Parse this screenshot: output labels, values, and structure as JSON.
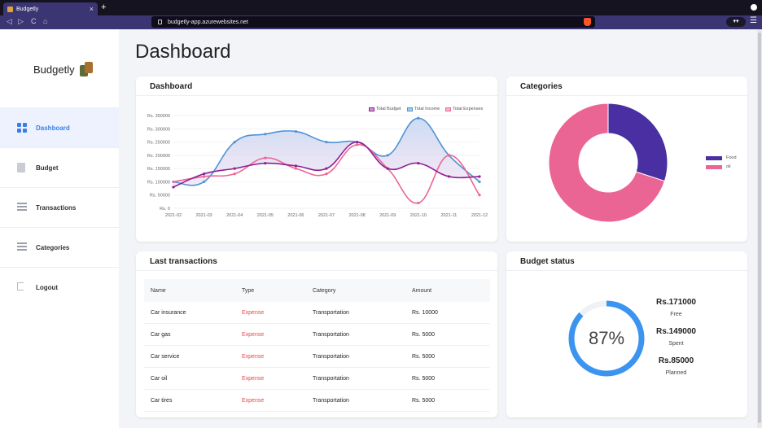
{
  "browser": {
    "tab_title": "Budgetly",
    "tab_close": "×",
    "new_tab": "+",
    "url": "budgetly-app.azurewebsites.net",
    "ext": "▾▾",
    "menu": "☰",
    "back": "◁",
    "forward": "▷",
    "reload": "C",
    "home": "⌂",
    "bookmark": "▯"
  },
  "sidebar": {
    "brand": "Budgetly",
    "items": [
      {
        "label": "Dashboard",
        "icon": "dashboard-grid-icon",
        "active": true
      },
      {
        "label": "Budget",
        "icon": "document-icon",
        "active": false
      },
      {
        "label": "Transactions",
        "icon": "list-icon",
        "active": false
      },
      {
        "label": "Categories",
        "icon": "list-icon",
        "active": false
      },
      {
        "label": "Logout",
        "icon": "logout-icon",
        "active": false
      }
    ]
  },
  "main": {
    "title": "Dashboard",
    "dashboard_card": {
      "title": "Dashboard"
    },
    "categories_card": {
      "title": "Categories"
    },
    "transactions_card": {
      "title": "Last transactions"
    },
    "budget_card": {
      "title": "Budget status"
    }
  },
  "chart_data": [
    {
      "type": "line",
      "x": [
        "2021-02",
        "2021-03",
        "2021-04",
        "2021-05",
        "2021-06",
        "2021-07",
        "2021-08",
        "2021-09",
        "2021-10",
        "2021-11",
        "2021-12"
      ],
      "ylim": [
        0,
        350000
      ],
      "yticks": [
        0,
        50000,
        100000,
        150000,
        200000,
        250000,
        300000,
        350000
      ],
      "ytick_labels": [
        "Rs. 0",
        "Rs. 50000",
        "Rs. 100000",
        "Rs. 150000",
        "Rs. 200000",
        "Rs. 250000",
        "Rs. 300000",
        "Rs. 350000"
      ],
      "legend_position": "top-right",
      "grid": true,
      "series": [
        {
          "name": "Total Budget",
          "color": "#8e1f93",
          "values": [
            80000,
            130000,
            150000,
            170000,
            160000,
            150000,
            250000,
            150000,
            170000,
            120000,
            120000
          ]
        },
        {
          "name": "Total Income",
          "color": "#4f93d4",
          "values": [
            100000,
            100000,
            250000,
            280000,
            290000,
            250000,
            250000,
            200000,
            340000,
            200000,
            100000
          ]
        },
        {
          "name": "Total Expenses",
          "color": "#ec6594",
          "values": [
            100000,
            120000,
            130000,
            190000,
            150000,
            130000,
            240000,
            150000,
            20000,
            200000,
            50000
          ]
        }
      ]
    },
    {
      "type": "pie",
      "labels": [
        "Food",
        "oil"
      ],
      "values": [
        30,
        70
      ],
      "colors": [
        "#4a2fa2",
        "#ea6593"
      ],
      "legend_position": "right"
    }
  ],
  "transactions": {
    "headers": [
      "Name",
      "Type",
      "Category",
      "Amount"
    ],
    "rows": [
      [
        "Car insurance",
        "Expense",
        "Transportation",
        "Rs. 10000"
      ],
      [
        "Car gas",
        "Expense",
        "Transportation",
        "Rs. 5000"
      ],
      [
        "Car service",
        "Expense",
        "Transportation",
        "Rs. 5000"
      ],
      [
        "Car oil",
        "Expense",
        "Transportation",
        "Rs. 5000"
      ],
      [
        "Car tires",
        "Expense",
        "Transportation",
        "Rs. 5000"
      ]
    ]
  },
  "budget_status": {
    "percent_label": "87%",
    "percent": 87,
    "ring_color": "#3b94f0",
    "stats": [
      {
        "value": "Rs.171000",
        "label": "Free"
      },
      {
        "value": "Rs.149000",
        "label": "Spent"
      },
      {
        "value": "Rs.85000",
        "label": "Planned"
      }
    ]
  }
}
